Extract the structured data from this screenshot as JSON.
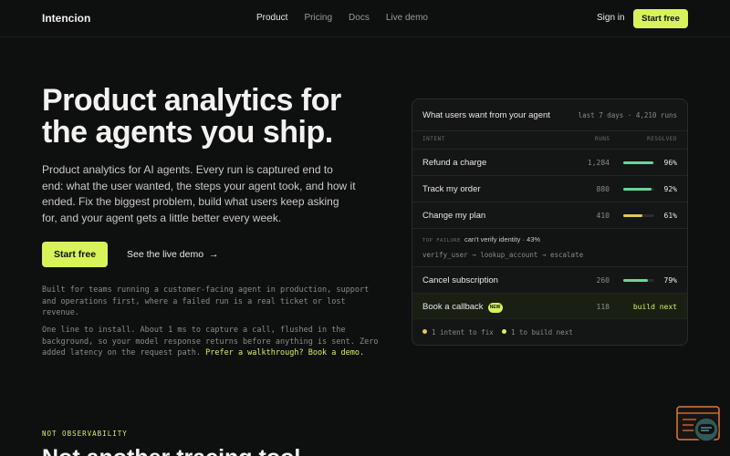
{
  "nav": {
    "logo": "Intencion",
    "links": [
      "Product",
      "Pricing",
      "Docs",
      "Live demo"
    ],
    "sign_in": "Sign in",
    "start_free": "Start free"
  },
  "hero": {
    "title": "Product analytics for the agents you ship.",
    "description": "Product analytics for AI agents. Every run is captured end to end: what the user wanted, the steps your agent took, and how it ended. Fix the biggest problem, build what users keep asking for, and your agent gets a little better every week.",
    "cta": "Start free",
    "demo_link": "See the live demo",
    "demo_arrow": "→",
    "note1": "Built for teams running a customer-facing agent in production, support and operations first, where a failed run is a real ticket or lost revenue.",
    "note2_text": "One line to install. About 1 ms to capture a call, flushed in the background, so your model response returns before anything is sent. Zero added latency on the request path. ",
    "note2_link": "Prefer a walkthrough? Book a demo."
  },
  "panel": {
    "title": "What users want from your agent",
    "meta": "last 7 days · 4,210 runs",
    "col_intent": "INTENT",
    "col_runs": "RUNS",
    "col_resolved": "RESOLVED",
    "rows": [
      {
        "name": "Refund a charge",
        "runs": "1,284",
        "pct": "96%",
        "resolved": 0.96,
        "color": "#6bd49a"
      },
      {
        "name": "Track my order",
        "runs": "880",
        "pct": "92%",
        "resolved": 0.92,
        "color": "#6bd49a"
      },
      {
        "name": "Change my plan",
        "runs": "410",
        "pct": "61%",
        "resolved": 0.61,
        "color": "#e6c65b"
      }
    ],
    "failure_label": "TOP FAILURE",
    "failure_text": "can't verify identity · 43%",
    "failure_path": "verify_user → lookup_account → escalate",
    "cancel": {
      "name": "Cancel subscription",
      "runs": "260",
      "pct": "79%",
      "resolved": 0.79,
      "color": "#6bd49a"
    },
    "callback": {
      "name": "Book a callback",
      "badge": "NEW",
      "runs": "118",
      "action": "build next"
    },
    "foot_fix": "1 intent to fix",
    "foot_build": "1 to build next"
  },
  "section2": {
    "eyebrow": "NOT OBSERVABILITY",
    "title": "Not another tracing tool"
  },
  "colors": {
    "accent": "#d6f35a",
    "background": "#0e0f0f"
  }
}
